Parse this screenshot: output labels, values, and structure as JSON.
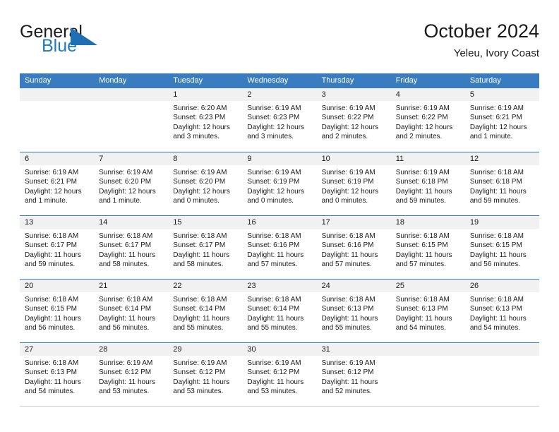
{
  "brand": {
    "name_part1": "General",
    "name_part2": "Blue",
    "accent_color": "#1f7ac4",
    "logo_icon": "triangle-flag-icon"
  },
  "header": {
    "title": "October 2024",
    "subtitle": "Yeleu, Ivory Coast"
  },
  "theme": {
    "header_row_color": "#3a7cc0",
    "day_band_color": "#f1f1f1",
    "row_divider_color": "#3a7cc0",
    "text_color": "#1a1a1a"
  },
  "weekdays": [
    "Sunday",
    "Monday",
    "Tuesday",
    "Wednesday",
    "Thursday",
    "Friday",
    "Saturday"
  ],
  "weeks": [
    [
      {
        "day": "",
        "sunrise": "",
        "sunset": "",
        "daylight_line1": "",
        "daylight_line2": "",
        "empty": true
      },
      {
        "day": "",
        "sunrise": "",
        "sunset": "",
        "daylight_line1": "",
        "daylight_line2": "",
        "empty": true
      },
      {
        "day": "1",
        "sunrise": "Sunrise: 6:20 AM",
        "sunset": "Sunset: 6:23 PM",
        "daylight_line1": "Daylight: 12 hours",
        "daylight_line2": "and 3 minutes.",
        "empty": false
      },
      {
        "day": "2",
        "sunrise": "Sunrise: 6:19 AM",
        "sunset": "Sunset: 6:23 PM",
        "daylight_line1": "Daylight: 12 hours",
        "daylight_line2": "and 3 minutes.",
        "empty": false
      },
      {
        "day": "3",
        "sunrise": "Sunrise: 6:19 AM",
        "sunset": "Sunset: 6:22 PM",
        "daylight_line1": "Daylight: 12 hours",
        "daylight_line2": "and 2 minutes.",
        "empty": false
      },
      {
        "day": "4",
        "sunrise": "Sunrise: 6:19 AM",
        "sunset": "Sunset: 6:22 PM",
        "daylight_line1": "Daylight: 12 hours",
        "daylight_line2": "and 2 minutes.",
        "empty": false
      },
      {
        "day": "5",
        "sunrise": "Sunrise: 6:19 AM",
        "sunset": "Sunset: 6:21 PM",
        "daylight_line1": "Daylight: 12 hours",
        "daylight_line2": "and 1 minute.",
        "empty": false
      }
    ],
    [
      {
        "day": "6",
        "sunrise": "Sunrise: 6:19 AM",
        "sunset": "Sunset: 6:21 PM",
        "daylight_line1": "Daylight: 12 hours",
        "daylight_line2": "and 1 minute.",
        "empty": false
      },
      {
        "day": "7",
        "sunrise": "Sunrise: 6:19 AM",
        "sunset": "Sunset: 6:20 PM",
        "daylight_line1": "Daylight: 12 hours",
        "daylight_line2": "and 1 minute.",
        "empty": false
      },
      {
        "day": "8",
        "sunrise": "Sunrise: 6:19 AM",
        "sunset": "Sunset: 6:20 PM",
        "daylight_line1": "Daylight: 12 hours",
        "daylight_line2": "and 0 minutes.",
        "empty": false
      },
      {
        "day": "9",
        "sunrise": "Sunrise: 6:19 AM",
        "sunset": "Sunset: 6:19 PM",
        "daylight_line1": "Daylight: 12 hours",
        "daylight_line2": "and 0 minutes.",
        "empty": false
      },
      {
        "day": "10",
        "sunrise": "Sunrise: 6:19 AM",
        "sunset": "Sunset: 6:19 PM",
        "daylight_line1": "Daylight: 12 hours",
        "daylight_line2": "and 0 minutes.",
        "empty": false
      },
      {
        "day": "11",
        "sunrise": "Sunrise: 6:19 AM",
        "sunset": "Sunset: 6:18 PM",
        "daylight_line1": "Daylight: 11 hours",
        "daylight_line2": "and 59 minutes.",
        "empty": false
      },
      {
        "day": "12",
        "sunrise": "Sunrise: 6:18 AM",
        "sunset": "Sunset: 6:18 PM",
        "daylight_line1": "Daylight: 11 hours",
        "daylight_line2": "and 59 minutes.",
        "empty": false
      }
    ],
    [
      {
        "day": "13",
        "sunrise": "Sunrise: 6:18 AM",
        "sunset": "Sunset: 6:17 PM",
        "daylight_line1": "Daylight: 11 hours",
        "daylight_line2": "and 59 minutes.",
        "empty": false
      },
      {
        "day": "14",
        "sunrise": "Sunrise: 6:18 AM",
        "sunset": "Sunset: 6:17 PM",
        "daylight_line1": "Daylight: 11 hours",
        "daylight_line2": "and 58 minutes.",
        "empty": false
      },
      {
        "day": "15",
        "sunrise": "Sunrise: 6:18 AM",
        "sunset": "Sunset: 6:17 PM",
        "daylight_line1": "Daylight: 11 hours",
        "daylight_line2": "and 58 minutes.",
        "empty": false
      },
      {
        "day": "16",
        "sunrise": "Sunrise: 6:18 AM",
        "sunset": "Sunset: 6:16 PM",
        "daylight_line1": "Daylight: 11 hours",
        "daylight_line2": "and 57 minutes.",
        "empty": false
      },
      {
        "day": "17",
        "sunrise": "Sunrise: 6:18 AM",
        "sunset": "Sunset: 6:16 PM",
        "daylight_line1": "Daylight: 11 hours",
        "daylight_line2": "and 57 minutes.",
        "empty": false
      },
      {
        "day": "18",
        "sunrise": "Sunrise: 6:18 AM",
        "sunset": "Sunset: 6:15 PM",
        "daylight_line1": "Daylight: 11 hours",
        "daylight_line2": "and 57 minutes.",
        "empty": false
      },
      {
        "day": "19",
        "sunrise": "Sunrise: 6:18 AM",
        "sunset": "Sunset: 6:15 PM",
        "daylight_line1": "Daylight: 11 hours",
        "daylight_line2": "and 56 minutes.",
        "empty": false
      }
    ],
    [
      {
        "day": "20",
        "sunrise": "Sunrise: 6:18 AM",
        "sunset": "Sunset: 6:15 PM",
        "daylight_line1": "Daylight: 11 hours",
        "daylight_line2": "and 56 minutes.",
        "empty": false
      },
      {
        "day": "21",
        "sunrise": "Sunrise: 6:18 AM",
        "sunset": "Sunset: 6:14 PM",
        "daylight_line1": "Daylight: 11 hours",
        "daylight_line2": "and 56 minutes.",
        "empty": false
      },
      {
        "day": "22",
        "sunrise": "Sunrise: 6:18 AM",
        "sunset": "Sunset: 6:14 PM",
        "daylight_line1": "Daylight: 11 hours",
        "daylight_line2": "and 55 minutes.",
        "empty": false
      },
      {
        "day": "23",
        "sunrise": "Sunrise: 6:18 AM",
        "sunset": "Sunset: 6:14 PM",
        "daylight_line1": "Daylight: 11 hours",
        "daylight_line2": "and 55 minutes.",
        "empty": false
      },
      {
        "day": "24",
        "sunrise": "Sunrise: 6:18 AM",
        "sunset": "Sunset: 6:13 PM",
        "daylight_line1": "Daylight: 11 hours",
        "daylight_line2": "and 55 minutes.",
        "empty": false
      },
      {
        "day": "25",
        "sunrise": "Sunrise: 6:18 AM",
        "sunset": "Sunset: 6:13 PM",
        "daylight_line1": "Daylight: 11 hours",
        "daylight_line2": "and 54 minutes.",
        "empty": false
      },
      {
        "day": "26",
        "sunrise": "Sunrise: 6:18 AM",
        "sunset": "Sunset: 6:13 PM",
        "daylight_line1": "Daylight: 11 hours",
        "daylight_line2": "and 54 minutes.",
        "empty": false
      }
    ],
    [
      {
        "day": "27",
        "sunrise": "Sunrise: 6:18 AM",
        "sunset": "Sunset: 6:13 PM",
        "daylight_line1": "Daylight: 11 hours",
        "daylight_line2": "and 54 minutes.",
        "empty": false
      },
      {
        "day": "28",
        "sunrise": "Sunrise: 6:19 AM",
        "sunset": "Sunset: 6:12 PM",
        "daylight_line1": "Daylight: 11 hours",
        "daylight_line2": "and 53 minutes.",
        "empty": false
      },
      {
        "day": "29",
        "sunrise": "Sunrise: 6:19 AM",
        "sunset": "Sunset: 6:12 PM",
        "daylight_line1": "Daylight: 11 hours",
        "daylight_line2": "and 53 minutes.",
        "empty": false
      },
      {
        "day": "30",
        "sunrise": "Sunrise: 6:19 AM",
        "sunset": "Sunset: 6:12 PM",
        "daylight_line1": "Daylight: 11 hours",
        "daylight_line2": "and 53 minutes.",
        "empty": false
      },
      {
        "day": "31",
        "sunrise": "Sunrise: 6:19 AM",
        "sunset": "Sunset: 6:12 PM",
        "daylight_line1": "Daylight: 11 hours",
        "daylight_line2": "and 52 minutes.",
        "empty": false
      },
      {
        "day": "",
        "sunrise": "",
        "sunset": "",
        "daylight_line1": "",
        "daylight_line2": "",
        "empty": true
      },
      {
        "day": "",
        "sunrise": "",
        "sunset": "",
        "daylight_line1": "",
        "daylight_line2": "",
        "empty": true
      }
    ]
  ]
}
